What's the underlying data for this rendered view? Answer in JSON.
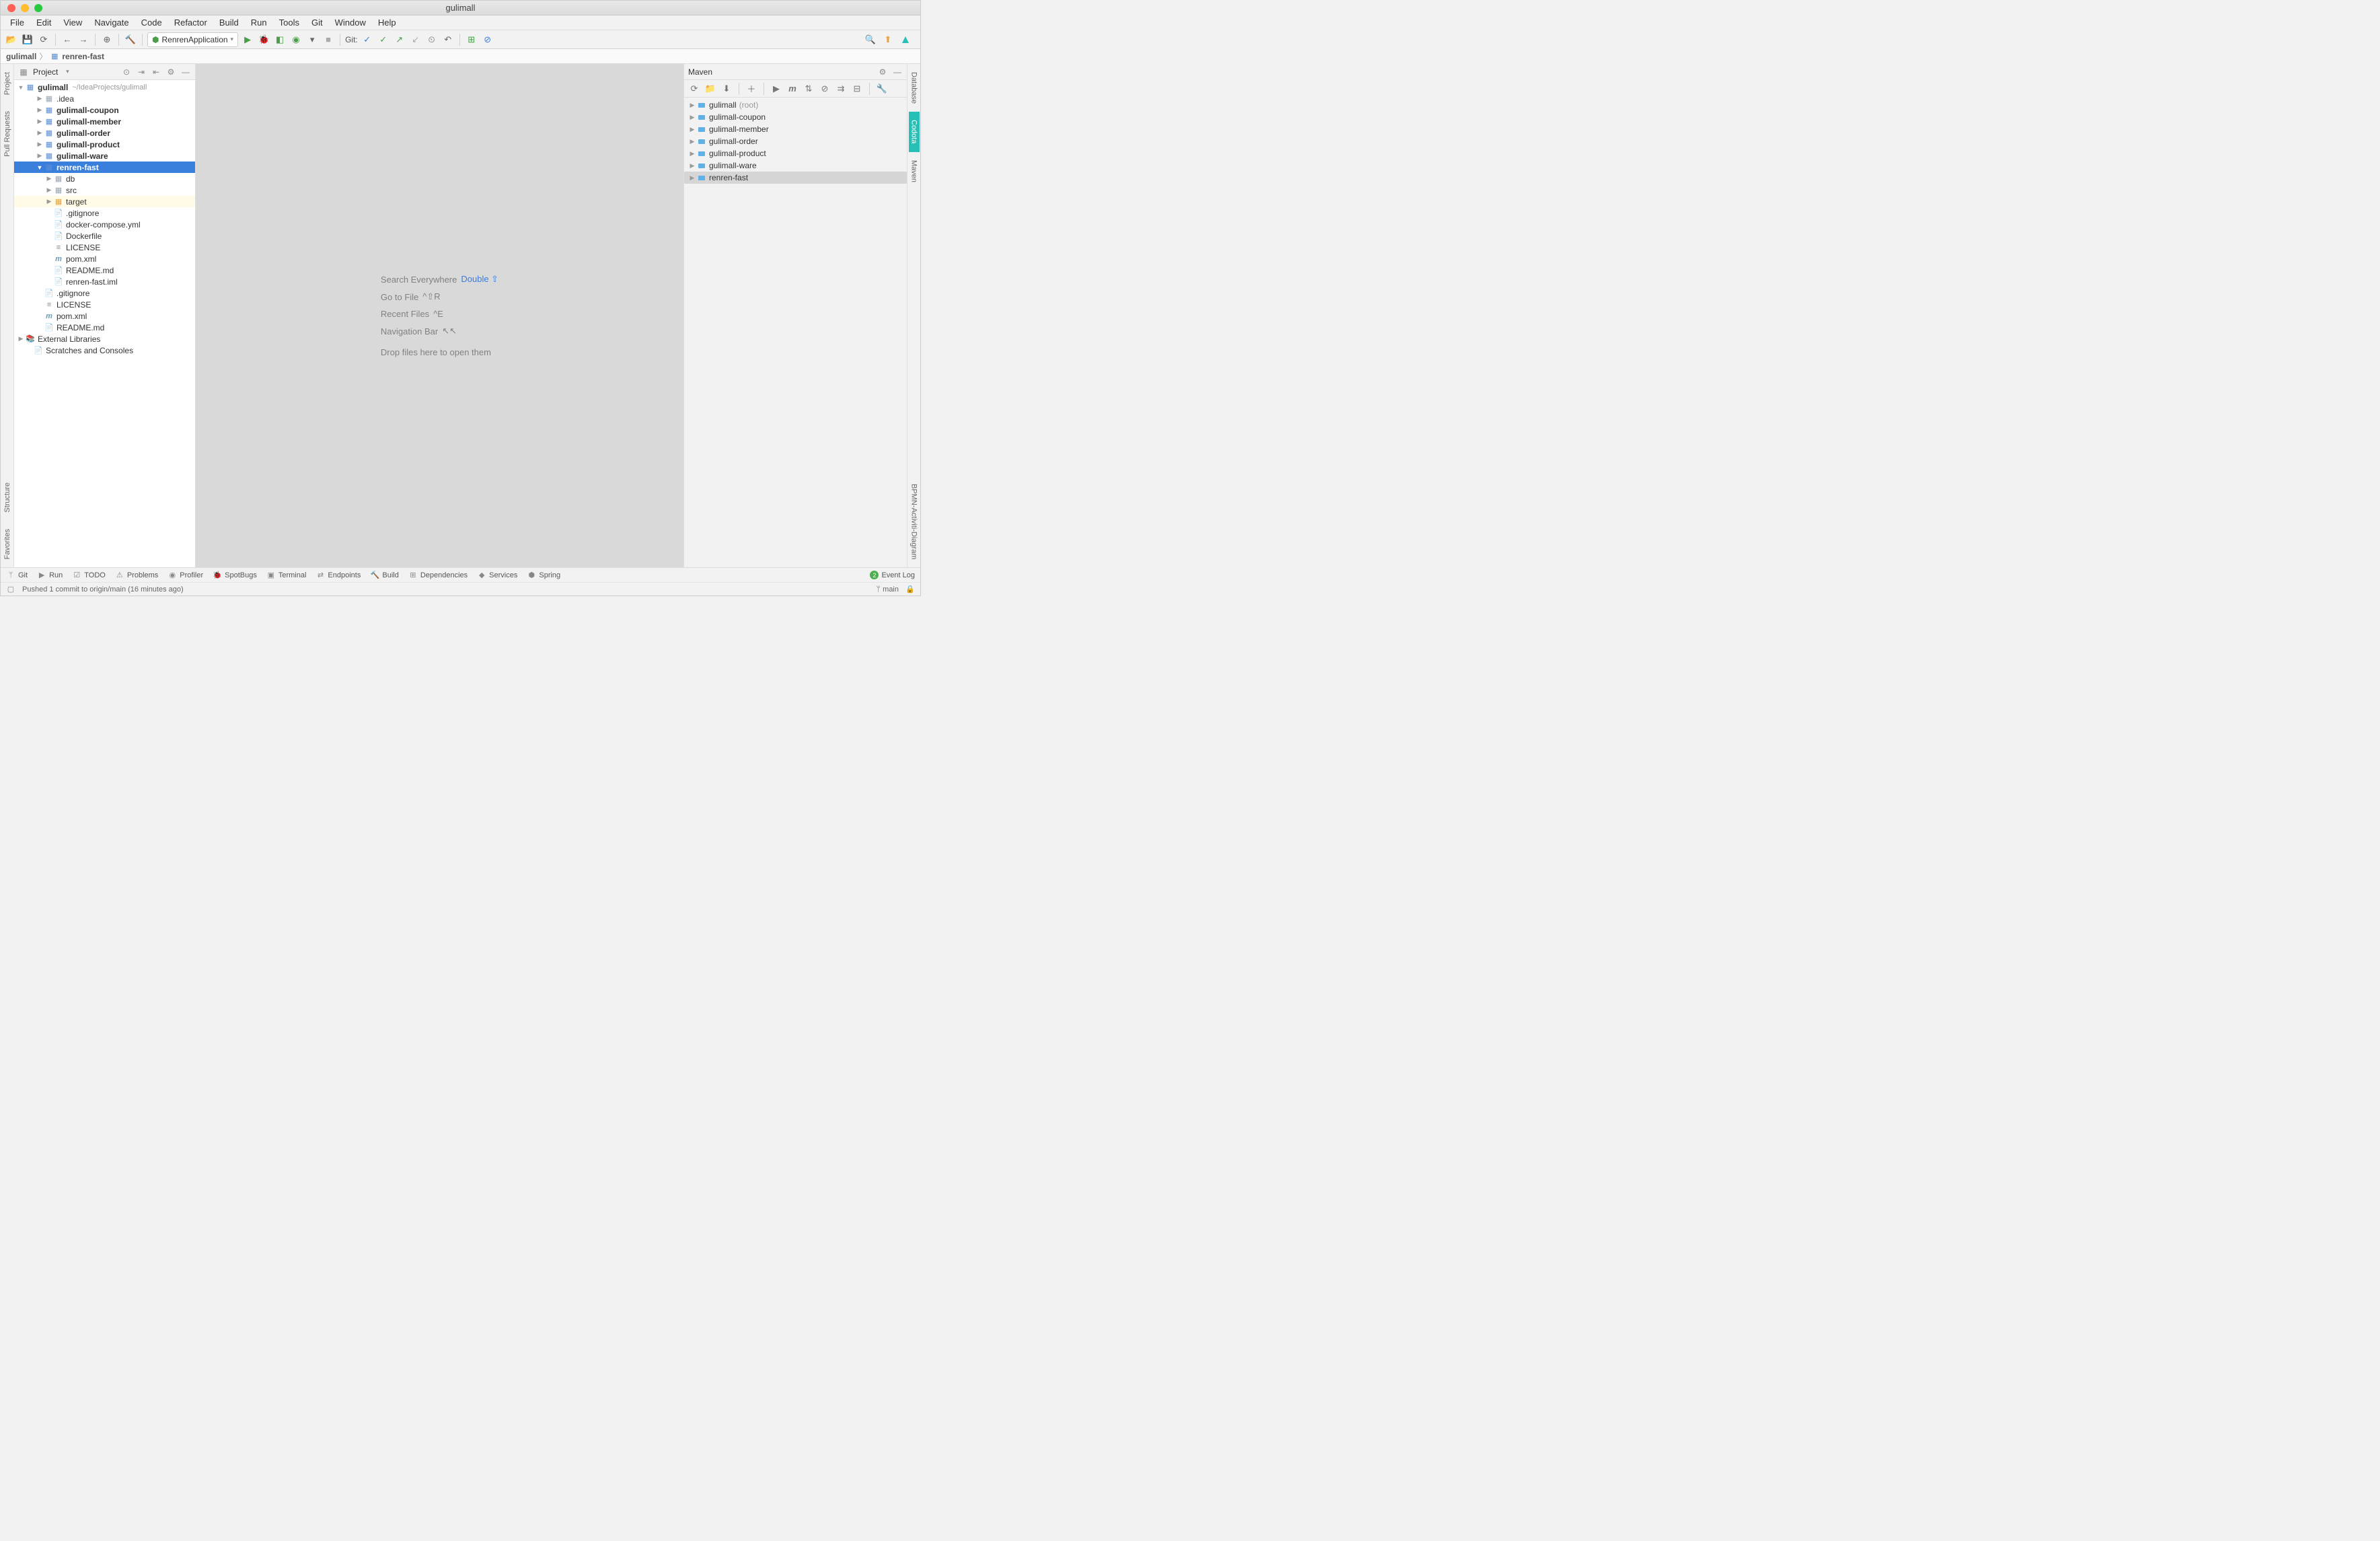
{
  "window": {
    "title": "gulimall"
  },
  "menu": [
    "File",
    "Edit",
    "View",
    "Navigate",
    "Code",
    "Refactor",
    "Build",
    "Run",
    "Tools",
    "Git",
    "Window",
    "Help"
  ],
  "toolbar": {
    "runConfig": "RenrenApplication",
    "gitLabel": "Git:"
  },
  "breadcrumb": {
    "root": "gulimall",
    "current": "renren-fast"
  },
  "project": {
    "title": "Project",
    "rootName": "gulimall",
    "rootPath": "~/IdeaProjects/gulimall",
    "items": [
      {
        "label": ".idea",
        "indent": 2,
        "arrow": "▶",
        "icon": "folder"
      },
      {
        "label": "gulimall-coupon",
        "indent": 2,
        "arrow": "▶",
        "icon": "module",
        "bold": true
      },
      {
        "label": "gulimall-member",
        "indent": 2,
        "arrow": "▶",
        "icon": "module",
        "bold": true
      },
      {
        "label": "gulimall-order",
        "indent": 2,
        "arrow": "▶",
        "icon": "module",
        "bold": true
      },
      {
        "label": "gulimall-product",
        "indent": 2,
        "arrow": "▶",
        "icon": "module",
        "bold": true
      },
      {
        "label": "gulimall-ware",
        "indent": 2,
        "arrow": "▶",
        "icon": "module",
        "bold": true
      },
      {
        "label": "renren-fast",
        "indent": 2,
        "arrow": "▼",
        "icon": "module-open",
        "bold": true,
        "selected": true
      },
      {
        "label": "db",
        "indent": 3,
        "arrow": "▶",
        "icon": "folder"
      },
      {
        "label": "src",
        "indent": 3,
        "arrow": "▶",
        "icon": "folder"
      },
      {
        "label": "target",
        "indent": 3,
        "arrow": "▶",
        "icon": "target",
        "excluded": true
      },
      {
        "label": ".gitignore",
        "indent": 3,
        "arrow": "",
        "icon": "file"
      },
      {
        "label": "docker-compose.yml",
        "indent": 3,
        "arrow": "",
        "icon": "file"
      },
      {
        "label": "Dockerfile",
        "indent": 3,
        "arrow": "",
        "icon": "file"
      },
      {
        "label": "LICENSE",
        "indent": 3,
        "arrow": "",
        "icon": "lic"
      },
      {
        "label": "pom.xml",
        "indent": 3,
        "arrow": "",
        "icon": "xml"
      },
      {
        "label": "README.md",
        "indent": 3,
        "arrow": "",
        "icon": "md"
      },
      {
        "label": "renren-fast.iml",
        "indent": 3,
        "arrow": "",
        "icon": "iml"
      },
      {
        "label": ".gitignore",
        "indent": 2,
        "arrow": "",
        "icon": "file"
      },
      {
        "label": "LICENSE",
        "indent": 2,
        "arrow": "",
        "icon": "lic"
      },
      {
        "label": "pom.xml",
        "indent": 2,
        "arrow": "",
        "icon": "xml"
      },
      {
        "label": "README.md",
        "indent": 2,
        "arrow": "",
        "icon": "md"
      }
    ],
    "extLib": "External Libraries",
    "scratches": "Scratches and Consoles"
  },
  "editor": {
    "hints": [
      {
        "label": "Search Everywhere",
        "key": "Double ⇧"
      },
      {
        "label": "Go to File",
        "key": "^⇧R",
        "gray": true
      },
      {
        "label": "Recent Files",
        "key": "^E",
        "gray": true
      },
      {
        "label": "Navigation Bar",
        "key": "↖↖",
        "gray": true
      }
    ],
    "dropText": "Drop files here to open them"
  },
  "maven": {
    "title": "Maven",
    "items": [
      {
        "label": "gulimall",
        "suffix": "(root)"
      },
      {
        "label": "gulimall-coupon"
      },
      {
        "label": "gulimall-member"
      },
      {
        "label": "gulimall-order"
      },
      {
        "label": "gulimall-product"
      },
      {
        "label": "gulimall-ware"
      },
      {
        "label": "renren-fast",
        "sel": true
      }
    ]
  },
  "leftStrip": [
    "Project",
    "Pull Requests",
    "Structure",
    "Favorites"
  ],
  "rightStrip": [
    "Database",
    "Codota",
    "Maven",
    "BPMN-Activiti-Diagram"
  ],
  "bottomBar": [
    "Git",
    "Run",
    "TODO",
    "Problems",
    "Profiler",
    "SpotBugs",
    "Terminal",
    "Endpoints",
    "Build",
    "Dependencies",
    "Services",
    "Spring"
  ],
  "eventLog": "Event Log",
  "status": {
    "message": "Pushed 1 commit to origin/main (16 minutes ago)",
    "branch": "main"
  }
}
